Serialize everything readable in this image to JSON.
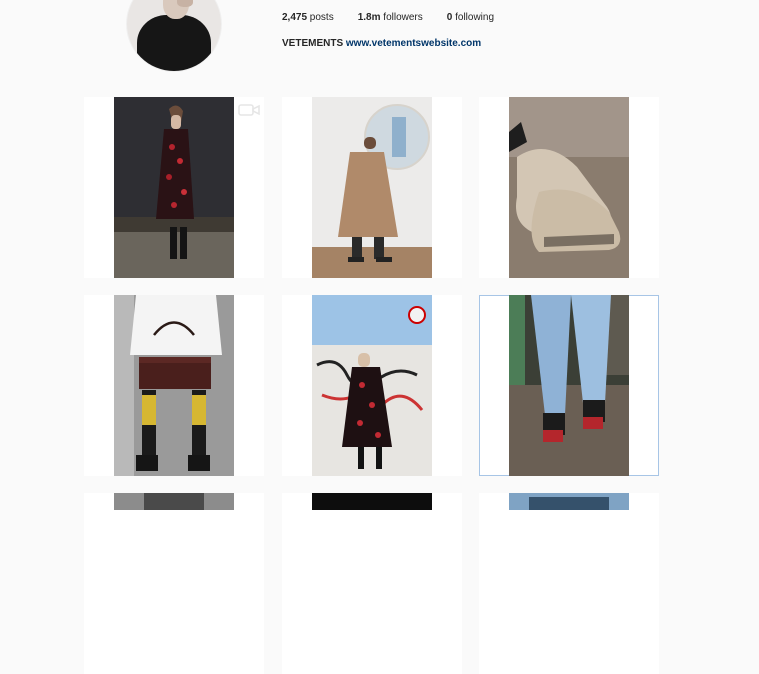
{
  "profile": {
    "stats": [
      {
        "count": "2,475",
        "label": " posts"
      },
      {
        "count": "1.8m",
        "label": " followers"
      },
      {
        "count": "0",
        "label": " following"
      }
    ],
    "bio_name": "VETEMENTS",
    "bio_link": "www.vetementswebsite.com"
  },
  "grid": {
    "posts": [
      {
        "name": "post-red-floral-dress-video",
        "has_video_badge": true
      },
      {
        "name": "post-trench-coat-mirror"
      },
      {
        "name": "post-beige-sneakers"
      },
      {
        "name": "post-brown-handbag-boots"
      },
      {
        "name": "post-floral-dress-graffiti"
      },
      {
        "name": "post-denim-red-heels",
        "selected": true
      },
      {
        "name": "post-row3-left"
      },
      {
        "name": "post-row3-middle"
      },
      {
        "name": "post-row3-right"
      }
    ]
  },
  "colors": {
    "link": "#003569",
    "selected_border": "#a7c5e6",
    "background": "#fafafa"
  },
  "icons": {
    "video_badge": "video-camera-icon"
  }
}
